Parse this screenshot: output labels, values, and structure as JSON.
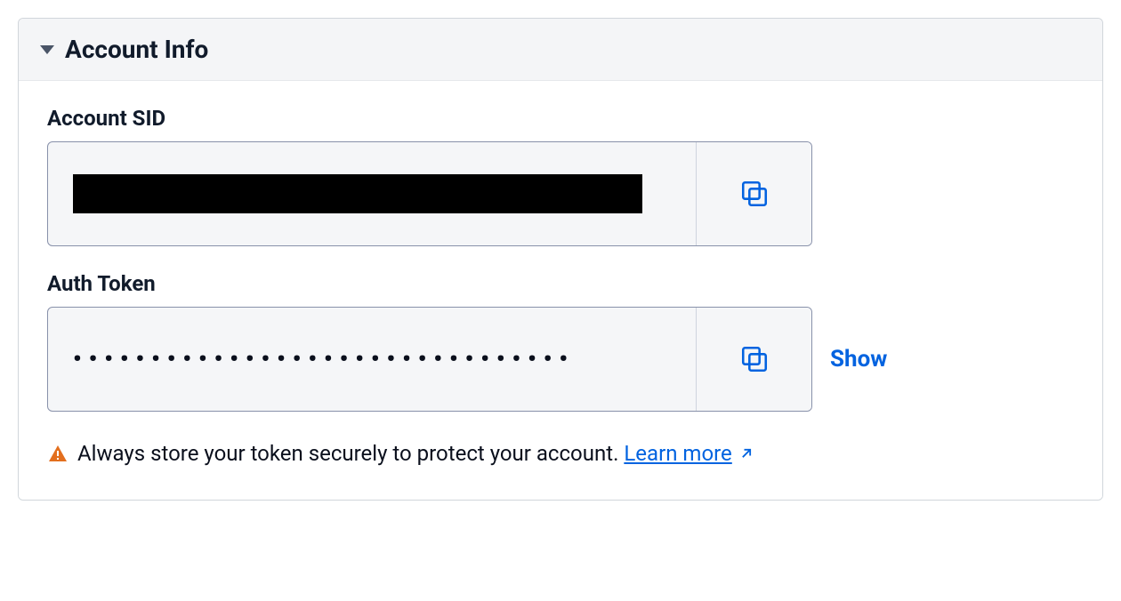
{
  "panel": {
    "title": "Account Info"
  },
  "fields": {
    "account_sid": {
      "label": "Account SID",
      "value_redacted": true
    },
    "auth_token": {
      "label": "Auth Token",
      "masked_value": "••••••••••••••••••••••••••••••••",
      "show_label": "Show"
    }
  },
  "warning": {
    "text": "Always store your token securely to protect your account. ",
    "link_text": "Learn more"
  },
  "colors": {
    "accent": "#0263e0",
    "warning_icon": "#e36f1e",
    "text": "#111b2b",
    "border": "#8891aa"
  }
}
